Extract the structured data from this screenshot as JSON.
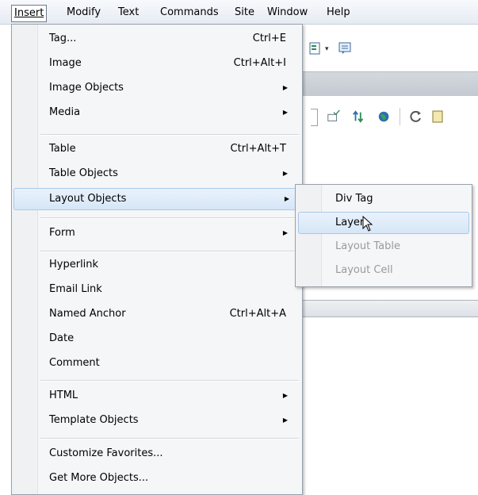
{
  "menubar": {
    "items": [
      "Insert",
      "Modify",
      "Text",
      "Commands",
      "Site",
      "Window",
      "Help"
    ]
  },
  "insert_menu": {
    "groups": [
      [
        {
          "label": "Tag...",
          "shortcut": "Ctrl+E"
        },
        {
          "label": "Image",
          "shortcut": "Ctrl+Alt+I"
        },
        {
          "label": "Image Objects",
          "submenu": true
        },
        {
          "label": "Media",
          "submenu": true
        }
      ],
      [
        {
          "label": "Table",
          "shortcut": "Ctrl+Alt+T"
        },
        {
          "label": "Table Objects",
          "submenu": true
        },
        {
          "label": "Layout Objects",
          "submenu": true,
          "highlighted": true
        }
      ],
      [
        {
          "label": "Form",
          "submenu": true
        }
      ],
      [
        {
          "label": "Hyperlink"
        },
        {
          "label": "Email Link"
        },
        {
          "label": "Named Anchor",
          "shortcut": "Ctrl+Alt+A"
        },
        {
          "label": "Date"
        },
        {
          "label": "Comment"
        }
      ],
      [
        {
          "label": "HTML",
          "submenu": true
        },
        {
          "label": "Template Objects",
          "submenu": true
        }
      ],
      [
        {
          "label": "Customize Favorites..."
        },
        {
          "label": "Get More Objects..."
        }
      ]
    ]
  },
  "layout_submenu": {
    "items": [
      {
        "label": "Div Tag"
      },
      {
        "label": "Layer",
        "highlighted": true
      },
      {
        "label": "Layout Table",
        "disabled": true
      },
      {
        "label": "Layout Cell",
        "disabled": true
      }
    ]
  },
  "icons": {
    "submenu_arrow": "submenu-arrow-icon",
    "cursor": "mouse-pointer-icon",
    "accent": "#a9c8ec"
  }
}
